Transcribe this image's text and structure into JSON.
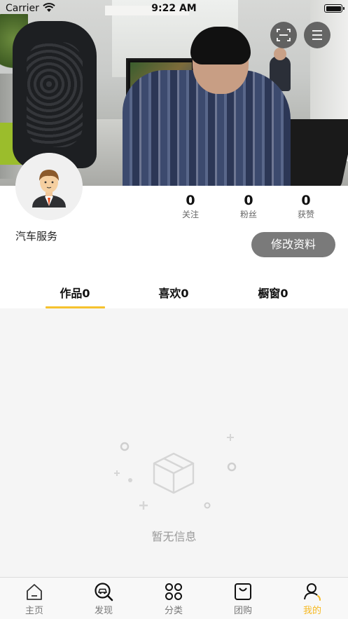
{
  "status_bar": {
    "carrier": "Carrier",
    "time": "9:22 AM"
  },
  "header": {
    "scan_icon": "scan-icon",
    "menu_icon": "menu-icon"
  },
  "profile": {
    "username": "汽车服务",
    "stats": [
      {
        "value": "0",
        "label": "关注"
      },
      {
        "value": "0",
        "label": "粉丝"
      },
      {
        "value": "0",
        "label": "获赞"
      }
    ],
    "edit_button": "修改资料"
  },
  "tabs": [
    {
      "label": "作品0",
      "active": true
    },
    {
      "label": "喜欢0",
      "active": false
    },
    {
      "label": "橱窗0",
      "active": false
    }
  ],
  "empty_state": {
    "text": "暂无信息",
    "icon": "empty-box-icon"
  },
  "tabbar": [
    {
      "label": "主页",
      "icon": "home-icon",
      "active": false
    },
    {
      "label": "发现",
      "icon": "discover-icon",
      "active": false
    },
    {
      "label": "分类",
      "icon": "category-icon",
      "active": false
    },
    {
      "label": "团购",
      "icon": "group-buy-icon",
      "active": false
    },
    {
      "label": "我的",
      "icon": "profile-icon",
      "active": true
    }
  ],
  "colors": {
    "accent": "#f6c22e",
    "active_tab_text": "#f6b820",
    "edit_button_bg": "#7a7a7a"
  }
}
